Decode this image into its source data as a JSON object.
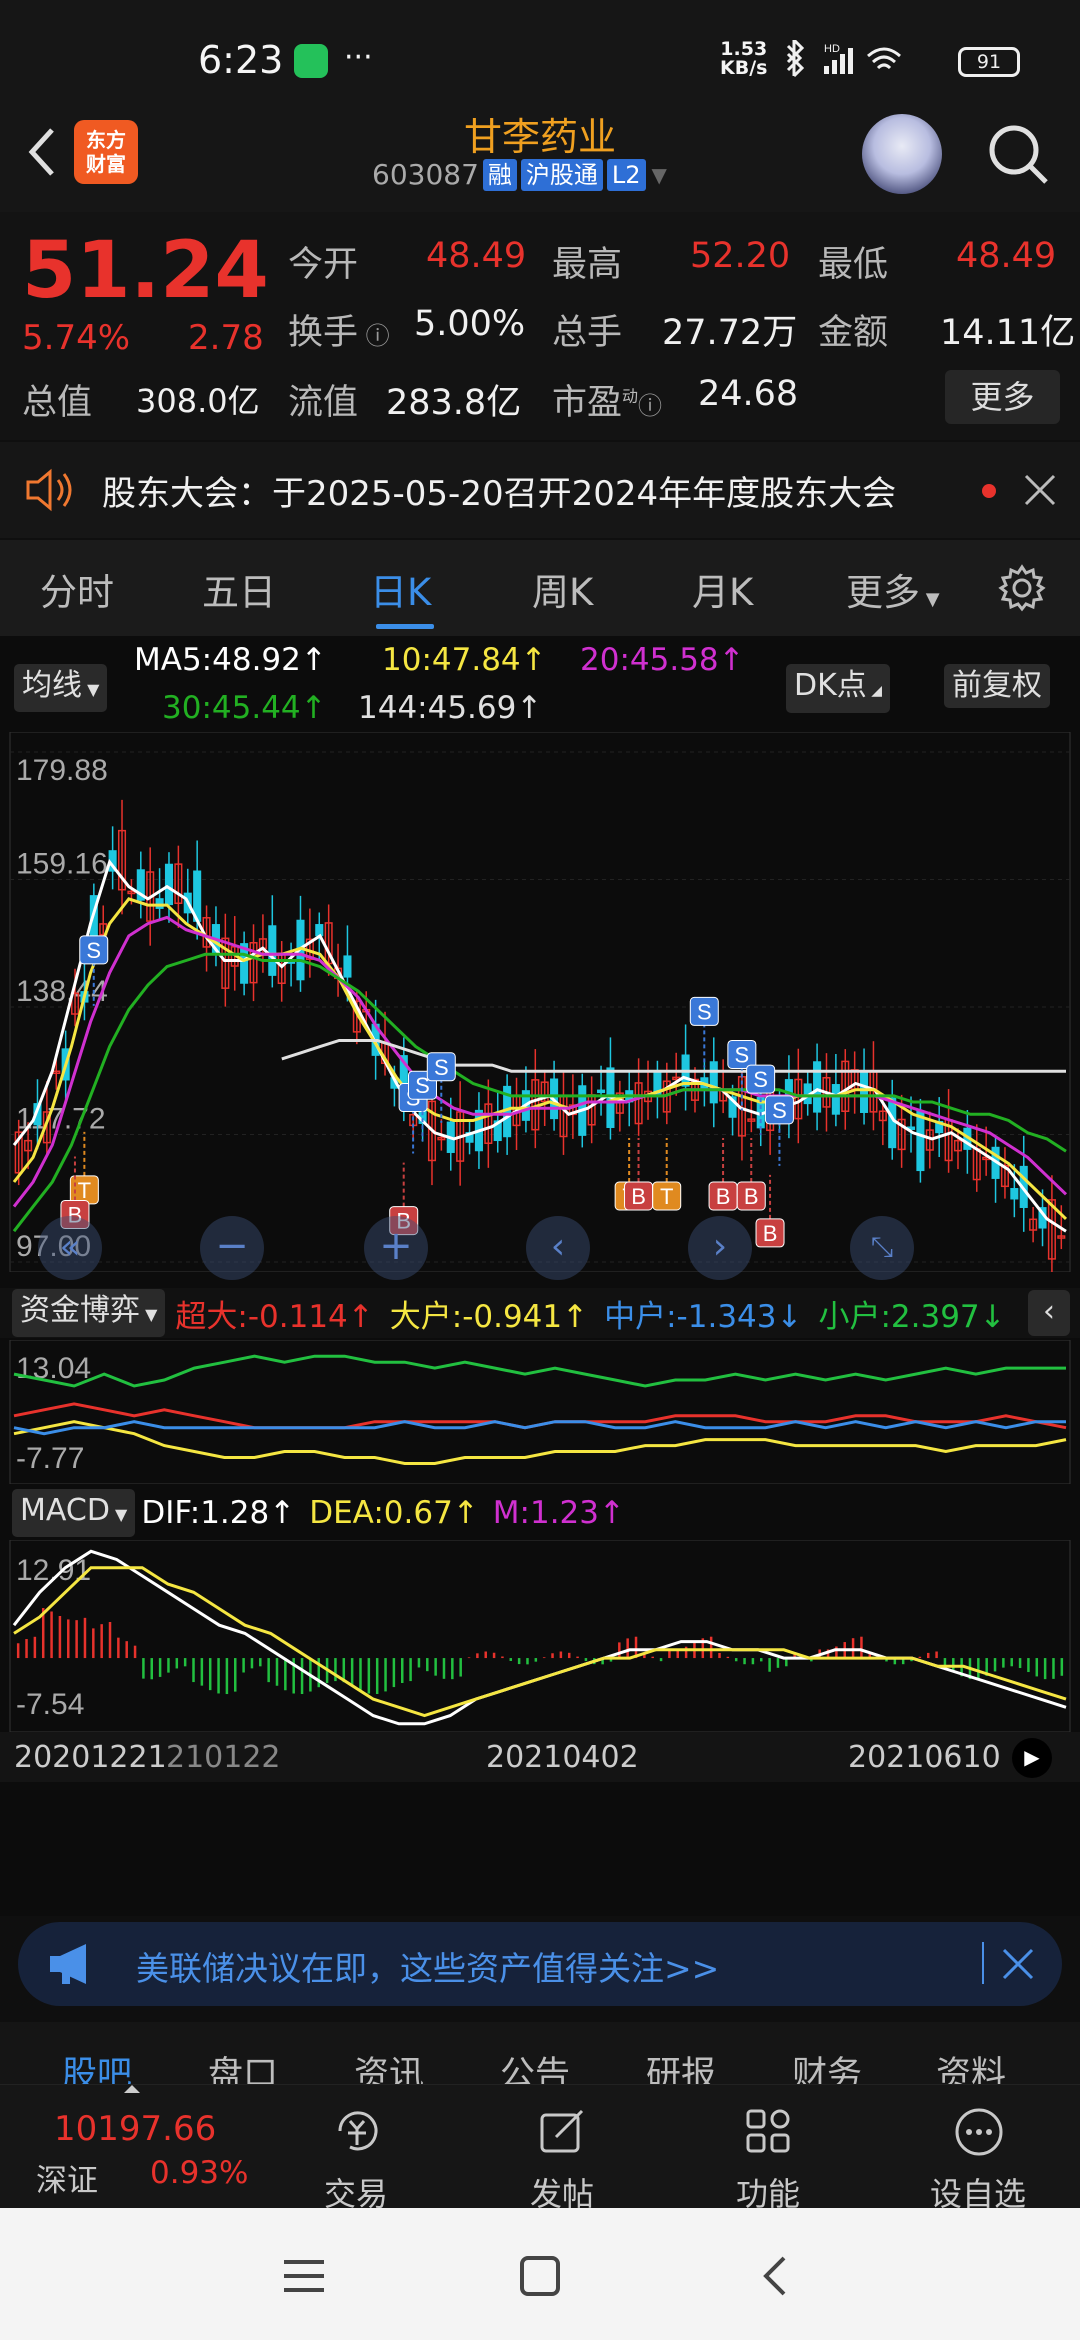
{
  "status_bar": {
    "time": "6:23",
    "net_speed_value": "1.53",
    "net_speed_unit": "KB/s",
    "battery": "91"
  },
  "header": {
    "logo_line1": "东方",
    "logo_line2": "财富",
    "stock_name": "甘李药业",
    "stock_code": "603087",
    "tags": [
      "融",
      "沪股通",
      "L2"
    ]
  },
  "quote": {
    "price": "51.24",
    "change_pct": "5.74%",
    "change_amt": "2.78",
    "open_label": "今开",
    "open": "48.49",
    "high_label": "最高",
    "high": "52.20",
    "low_label": "最低",
    "low": "48.49",
    "turnover_label": "换手",
    "turnover": "5.00%",
    "volume_label": "总手",
    "volume": "27.72万",
    "amount_label": "金额",
    "amount": "14.11亿",
    "mktcap_label": "总值",
    "mktcap": "308.0亿",
    "float_label": "流值",
    "float": "283.8亿",
    "pe_label": "市盈",
    "pe_sup": "动",
    "pe": "24.68",
    "more_label": "更多"
  },
  "notice": {
    "text": "股东大会：于2025-05-20召开2024年年度股东大会"
  },
  "tabs": [
    {
      "label": "分时"
    },
    {
      "label": "五日"
    },
    {
      "label": "日K"
    },
    {
      "label": "周K"
    },
    {
      "label": "月K"
    },
    {
      "label": "更多"
    }
  ],
  "chart_controls": {
    "ma_label": "均线",
    "ma5": "MA5:48.92↑",
    "ma10": "10:47.84↑",
    "ma20": "20:45.58↑",
    "ma30": "30:45.44↑",
    "ma144": "144:45.69↑",
    "dk_label": "DK点",
    "adjust_label": "前复权"
  },
  "fund_controls": {
    "label": "资金博弈",
    "super": "超大:-0.114↑",
    "large": "大户:-0.941↑",
    "mid": "中户:-1.343↓",
    "small": "小户:2.397↓"
  },
  "macd_controls": {
    "label": "MACD",
    "dif": "DIF:1.28↑",
    "dea": "DEA:0.67↑",
    "m": "M:1.23↑"
  },
  "banner": {
    "text": "美联储决议在即，这些资产值得关注>>"
  },
  "subtabs": [
    {
      "label": "股吧"
    },
    {
      "label": "盘口"
    },
    {
      "label": "资讯"
    },
    {
      "label": "公告"
    },
    {
      "label": "研报"
    },
    {
      "label": "财务"
    },
    {
      "label": "资料"
    }
  ],
  "bottom_bar": {
    "index_value": "10197.66",
    "index_name": "深证",
    "index_pct": "0.93%",
    "items": [
      {
        "label": "交易"
      },
      {
        "label": "发帖"
      },
      {
        "label": "功能"
      },
      {
        "label": "设自选"
      }
    ]
  },
  "colors": {
    "up": "#e8322c",
    "down": "#1ec7e0",
    "accent": "#3b8ee8",
    "ma5": "#ffffff",
    "ma10": "#f5e642",
    "ma20": "#d030d0",
    "ma30": "#22b022",
    "ma144": "#e0e0e0"
  },
  "chart_data": [
    {
      "type": "line",
      "name": "daily-kline",
      "ylim": [
        97.0,
        179.88
      ],
      "y_ticks": [
        "179.88",
        "159.16",
        "138.44",
        "117.72",
        "97.00"
      ],
      "x_ticks": [
        "20201221",
        "210122",
        "20210402",
        "20210610"
      ],
      "markers": [
        {
          "label": "S",
          "x_index": 7,
          "y": 150
        },
        {
          "label": "T",
          "x_index": 6,
          "y": 111
        },
        {
          "label": "B",
          "x_index": 5,
          "y": 107
        },
        {
          "label": "S",
          "x_index": 41,
          "y": 126
        },
        {
          "label": "S",
          "x_index": 42,
          "y": 128
        },
        {
          "label": "S",
          "x_index": 44,
          "y": 131
        },
        {
          "label": "B",
          "x_index": 40,
          "y": 106
        },
        {
          "label": "S",
          "x_index": 72,
          "y": 140
        },
        {
          "label": "S",
          "x_index": 76,
          "y": 133
        },
        {
          "label": "S",
          "x_index": 78,
          "y": 129
        },
        {
          "label": "S",
          "x_index": 80,
          "y": 124
        },
        {
          "label": "T",
          "x_index": 64,
          "y": 110
        },
        {
          "label": "B",
          "x_index": 65,
          "y": 110
        },
        {
          "label": "T",
          "x_index": 68,
          "y": 110
        },
        {
          "label": "B",
          "x_index": 74,
          "y": 110
        },
        {
          "label": "B",
          "x_index": 77,
          "y": 110
        },
        {
          "label": "B",
          "x_index": 79,
          "y": 104
        }
      ],
      "series": [
        {
          "name": "MA5",
          "values": [
            116,
            120,
            128,
            140,
            152,
            162,
            158,
            156,
            158,
            156,
            150,
            146,
            146,
            148,
            145,
            148,
            150,
            144,
            138,
            132,
            126,
            121,
            118,
            117,
            118,
            119,
            121,
            123,
            124,
            121,
            122,
            124,
            123,
            124,
            125,
            127,
            126,
            125,
            122,
            121,
            122,
            123,
            125,
            124,
            126,
            125,
            120,
            118,
            117,
            118,
            116,
            114,
            112,
            108,
            104,
            102
          ]
        },
        {
          "name": "MA10",
          "values": [
            110,
            114,
            122,
            132,
            144,
            152,
            156,
            155,
            155,
            152,
            150,
            148,
            146,
            147,
            147,
            148,
            147,
            143,
            137,
            132,
            127,
            123,
            121,
            120,
            120,
            121,
            122,
            122,
            123,
            122,
            123,
            123,
            124,
            124,
            125,
            126,
            126,
            125,
            124,
            123,
            123,
            124,
            124,
            124,
            125,
            125,
            123,
            121,
            120,
            119,
            117,
            115,
            113,
            110,
            107,
            104
          ]
        },
        {
          "name": "MA20",
          "values": [
            106,
            110,
            116,
            126,
            136,
            144,
            150,
            152,
            153,
            151,
            150,
            149,
            148,
            147,
            147,
            147,
            146,
            143,
            140,
            135,
            131,
            127,
            124,
            122,
            121,
            121,
            121,
            122,
            122,
            122,
            123,
            123,
            123,
            124,
            124,
            125,
            125,
            125,
            125,
            124,
            124,
            124,
            124,
            124,
            124,
            124,
            123,
            122,
            121,
            120,
            119,
            118,
            116,
            114,
            111,
            108
          ]
        },
        {
          "name": "MA30",
          "values": [
            102,
            106,
            110,
            116,
            124,
            132,
            138,
            142,
            145,
            146,
            147,
            147,
            147,
            146,
            146,
            146,
            145,
            143,
            141,
            138,
            135,
            132,
            130,
            128,
            126,
            125,
            124,
            124,
            124,
            124,
            124,
            124,
            124,
            124,
            124,
            125,
            125,
            125,
            125,
            125,
            125,
            124,
            124,
            124,
            124,
            124,
            124,
            123,
            123,
            122,
            121,
            121,
            120,
            118,
            117,
            115
          ]
        },
        {
          "name": "MA144",
          "values": [
            null,
            null,
            null,
            null,
            null,
            null,
            null,
            null,
            null,
            null,
            null,
            null,
            null,
            null,
            130,
            131,
            132,
            133,
            133,
            133,
            132,
            131,
            130,
            129,
            129,
            129,
            128,
            128,
            128,
            128,
            128,
            128,
            128,
            128,
            128,
            128,
            128,
            128,
            128,
            128,
            128,
            128,
            128,
            128,
            128,
            128,
            128,
            128,
            128,
            128,
            128,
            128,
            128,
            128,
            128,
            128
          ]
        }
      ]
    },
    {
      "type": "line",
      "name": "fund-flow",
      "ylim": [
        -7.77,
        13.04
      ],
      "y_ticks": [
        "13.04",
        "-7.77"
      ],
      "series": [
        {
          "name": "超大",
          "values": [
            2,
            3,
            4,
            3,
            2,
            3,
            2,
            1,
            0,
            0,
            0,
            0,
            1,
            1,
            1,
            1,
            1,
            0,
            1,
            1,
            1,
            1,
            2,
            2,
            2,
            1,
            1,
            1,
            2,
            2,
            1,
            1,
            1,
            2,
            1,
            0
          ]
        },
        {
          "name": "大户",
          "values": [
            -1,
            0,
            1,
            0,
            -1,
            -3,
            -4,
            -5,
            -5,
            -4,
            -4,
            -5,
            -5,
            -6,
            -6,
            -5,
            -5,
            -5,
            -4,
            -4,
            -4,
            -3,
            -3,
            -2,
            -2,
            -2,
            -3,
            -3,
            -3,
            -3,
            -3,
            -4,
            -3,
            -3,
            -3,
            -2
          ]
        },
        {
          "name": "中户",
          "values": [
            0,
            -1,
            0,
            0,
            1,
            0,
            0,
            0,
            0,
            0,
            0,
            0,
            0,
            1,
            0,
            0,
            1,
            0,
            1,
            1,
            0,
            0,
            1,
            0,
            0,
            0,
            1,
            0,
            1,
            0,
            1,
            0,
            1,
            0,
            1,
            1
          ]
        },
        {
          "name": "小户",
          "values": [
            9,
            8,
            7,
            9,
            7,
            8,
            10,
            11,
            12,
            11,
            12,
            12,
            11,
            11,
            10,
            11,
            10,
            9,
            10,
            9,
            8,
            7,
            8,
            8,
            9,
            8,
            9,
            8,
            9,
            8,
            9,
            10,
            9,
            10,
            10,
            10
          ]
        }
      ]
    },
    {
      "type": "line",
      "name": "macd",
      "ylim": [
        -7.54,
        12.91
      ],
      "y_ticks": [
        "12.91",
        "-7.54"
      ],
      "series": [
        {
          "name": "DIF",
          "values": [
            4,
            8,
            11,
            13,
            12,
            10,
            8,
            6,
            4,
            3,
            1,
            -1,
            -3,
            -5,
            -7,
            -8,
            -8,
            -7,
            -5,
            -4,
            -3,
            -2,
            -1,
            0,
            1,
            1,
            2,
            2,
            1,
            1,
            0,
            0,
            1,
            1,
            0,
            0,
            -1,
            -2,
            -3,
            -4,
            -5,
            -6
          ]
        },
        {
          "name": "DEA",
          "values": [
            3,
            5,
            8,
            11,
            11,
            11,
            9,
            8,
            6,
            4,
            3,
            1,
            -1,
            -3,
            -5,
            -6,
            -7,
            -6,
            -5,
            -4,
            -3,
            -2,
            -1,
            0,
            0,
            1,
            1,
            1,
            1,
            1,
            1,
            0,
            0,
            0,
            0,
            0,
            -1,
            -1,
            -2,
            -3,
            -4,
            -5
          ]
        }
      ]
    }
  ]
}
